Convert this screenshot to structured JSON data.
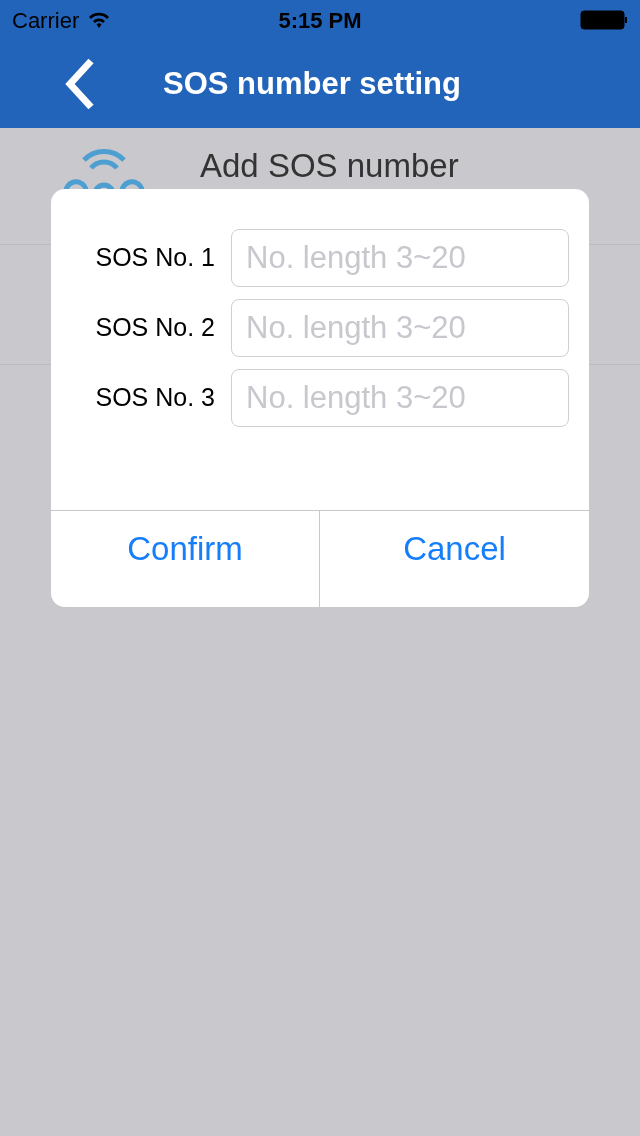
{
  "status_bar": {
    "carrier": "Carrier",
    "time": "5:15 PM"
  },
  "nav_bar": {
    "title": "SOS number setting"
  },
  "list": [
    {
      "label": "Add SOS number"
    }
  ],
  "dialog": {
    "fields": [
      {
        "label": "SOS No. 1",
        "placeholder": "No. length 3~20"
      },
      {
        "label": "SOS No. 2",
        "placeholder": "No. length 3~20"
      },
      {
        "label": "SOS No. 3",
        "placeholder": "No. length 3~20"
      }
    ],
    "buttons": [
      "Confirm",
      "Cancel"
    ]
  }
}
